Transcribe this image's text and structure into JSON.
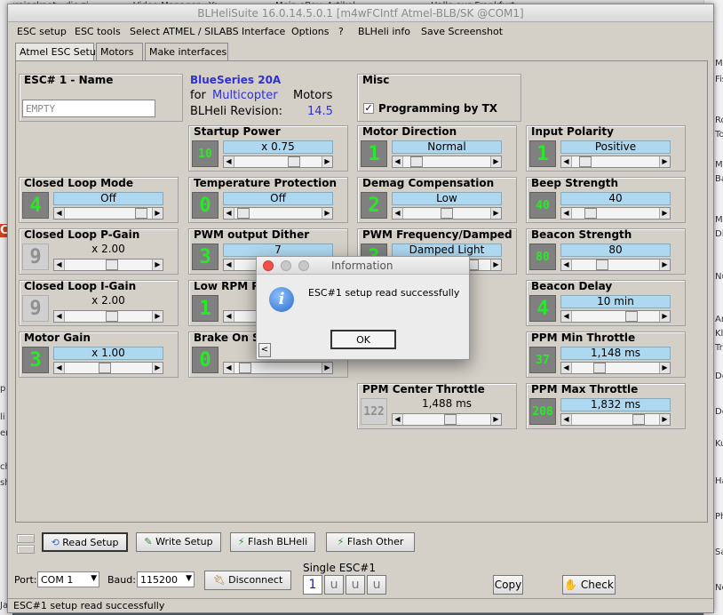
{
  "app": {
    "title": "BLHeliSuite 16.0.14.5.0.1  [m4wFCIntf Atmel-BLB/SK @COM1]"
  },
  "bg": {
    "top": [
      "Eurojackpot - die zi...",
      "Video Manager - Yo...",
      "Mein eBay: Artikel...",
      "Hallo aus Frankfurt"
    ],
    "left": [
      "C",
      "p",
      "li",
      "erk",
      "ch",
      "sh",
      "Ja"
    ],
    "right": [
      "Mi",
      "Fis",
      "Ro",
      "Tot",
      "Mi",
      "Ba",
      "Ma",
      "Di",
      "Nu",
      "An",
      "Kle",
      "Tra",
      "Do",
      "De",
      "Ku",
      "Ha",
      "Ph",
      "Sa",
      "Ne"
    ]
  },
  "menu": [
    "ESC setup",
    "ESC tools",
    "Select ATMEL / SILABS Interface",
    "Options",
    "?",
    "BLHeli info",
    "Save Screenshot"
  ],
  "tabs": [
    "Atmel ESC Setup",
    "Motors",
    "Make interfaces"
  ],
  "esc_name": {
    "title": "ESC# 1 - Name",
    "value": "EMPTY"
  },
  "info": {
    "series": "BlueSeries 20A",
    "for_label": "for",
    "for_value": "Multicopter",
    "motors": "Motors",
    "rev_label": "BLHeli Revision:",
    "rev_value": "14.5"
  },
  "misc": {
    "title": "Misc",
    "checkbox_label": "Programming by TX",
    "checked": true
  },
  "params": {
    "startup_power": {
      "title": "Startup Power",
      "ind": "10",
      "value": "x 0.75",
      "pos": 0.72
    },
    "motor_direction": {
      "title": "Motor Direction",
      "ind": "1",
      "value": "Normal",
      "pos": 0.08
    },
    "input_polarity": {
      "title": "Input Polarity",
      "ind": "1",
      "value": "Positive",
      "pos": 0.08
    },
    "closed_loop_mode": {
      "title": "Closed Loop Mode",
      "ind": "4",
      "value": "Off",
      "pos": 0.95
    },
    "temperature_protection": {
      "title": "Temperature Protection",
      "ind": "0",
      "value": "Off",
      "pos": 0.02
    },
    "demag_compensation": {
      "title": "Demag Compensation",
      "ind": "2",
      "value": "Low",
      "pos": 0.5
    },
    "beep_strength": {
      "title": "Beep Strength",
      "ind": "40",
      "value": "40",
      "pos": 0.16
    },
    "closed_loop_p_gain": {
      "title": "Closed Loop P-Gain",
      "ind": "9",
      "value": "x 2.00",
      "pos": 0.55
    },
    "pwm_output_dither": {
      "title": "PWM output Dither",
      "ind": "3",
      "value": "7",
      "pos": 0.42
    },
    "pwm_frequency_damped": {
      "title": "PWM Frequency/Damped",
      "ind": "3",
      "value": "Damped Light",
      "pos": 0.85
    },
    "beacon_strength": {
      "title": "Beacon Strength",
      "ind": "80",
      "value": "80",
      "pos": 0.32
    },
    "closed_loop_i_gain": {
      "title": "Closed Loop I-Gain",
      "ind": "9",
      "value": "x 2.00",
      "pos": 0.55
    },
    "low_rpm_power_protect": {
      "title": "Low RPM Po",
      "ind": "1",
      "value": "",
      "pos": 0.5
    },
    "beacon_delay": {
      "title": "Beacon Delay",
      "ind": "4",
      "value": "10 min",
      "pos": 0.72
    },
    "motor_gain": {
      "title": "Motor Gain",
      "ind": "3",
      "value": "x 1.00",
      "pos": 0.45
    },
    "brake_on_stop": {
      "title": "Brake On S",
      "ind": "0",
      "value": "",
      "pos": 0.05
    },
    "ppm_min_throttle": {
      "title": "PPM Min Throttle",
      "ind": "37",
      "value": "1,148 ms",
      "pos": 0.28
    },
    "ppm_center_throttle": {
      "title": "PPM Center Throttle",
      "ind": "122",
      "value": "1,488 ms",
      "pos": 0.55
    },
    "ppm_max_throttle": {
      "title": "PPM Max Throttle",
      "ind": "208",
      "value": "1,832 ms",
      "pos": 0.82
    }
  },
  "actions": {
    "read": "Read Setup",
    "write": "Write Setup",
    "flash_blheli": "Flash BLHeli",
    "flash_other": "Flash Other"
  },
  "port": {
    "label": "Port:",
    "value": "COM 1",
    "baud_label": "Baud:",
    "baud_value": "115200",
    "disconnect": "Disconnect",
    "single_title": "Single ESC#1",
    "esc_slots": [
      "1",
      "u",
      "u",
      "u"
    ],
    "copy": "Copy",
    "check": "Check"
  },
  "status": "ESC#1 setup read successfully",
  "dialog": {
    "title": "Information",
    "message": "ESC#1 setup read successfully",
    "ok": "OK"
  },
  "colors": {
    "led": "#28e828",
    "value_bg": "#add8f0",
    "series": "#3030d0",
    "info_icon": "#2a6cc8"
  }
}
